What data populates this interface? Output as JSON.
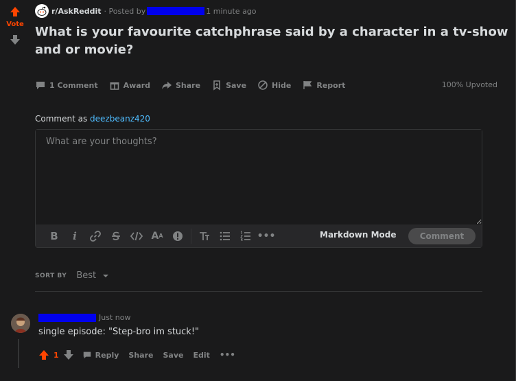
{
  "colors": {
    "accent": "#ff4500",
    "link": "#4fbcff",
    "redaction": "#0000ee"
  },
  "vote": {
    "label": "Vote"
  },
  "post": {
    "subreddit": "r/AskReddit",
    "posted_by": "· Posted by",
    "time": "1 minute ago",
    "title": "What is your favourite catchphrase said by a character in a tv-show and or movie?",
    "upvoted": "100% Upvoted"
  },
  "actions": {
    "comments": "1 Comment",
    "award": "Award",
    "share": "Share",
    "save": "Save",
    "hide": "Hide",
    "report": "Report"
  },
  "composer": {
    "comment_as_label": "Comment as",
    "username": "deezbeanz420",
    "placeholder": "What are your thoughts?",
    "markdown_mode": "Markdown Mode",
    "submit": "Comment",
    "toolbar_icons": [
      "bold-icon",
      "italic-icon",
      "link-icon",
      "strikethrough-icon",
      "inline-code-icon",
      "superscript-icon",
      "spoiler-icon",
      "heading-icon",
      "bulleted-list-icon",
      "numbered-list-icon",
      "more-icon"
    ]
  },
  "sort": {
    "label": "SORT BY",
    "value": "Best"
  },
  "comment": {
    "time": "Just now",
    "body": "single episode: \"Step-bro im stuck!\"",
    "score": "1",
    "reply": "Reply",
    "share": "Share",
    "save": "Save",
    "edit": "Edit"
  }
}
